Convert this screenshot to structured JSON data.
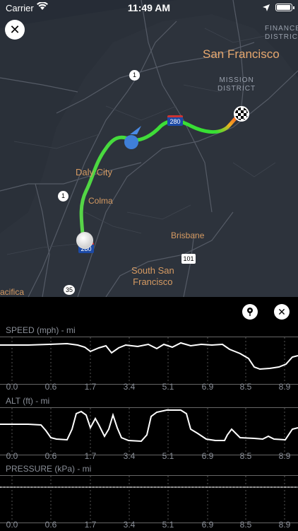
{
  "status": {
    "carrier": "Carrier",
    "time": "11:49 AM",
    "battery_percent": 90
  },
  "map": {
    "labels": {
      "sf": "San Francisco",
      "financial": "FINANCE\nDISTRICT",
      "mission": "MISSION\nDISTRICT",
      "daly": "Daly City",
      "colma": "Colma",
      "brisbane": "Brisbane",
      "ssf": "South San\nFrancisco",
      "pacifica": "acifica"
    },
    "shields": {
      "r1a": "1",
      "r1b": "1",
      "i280a": "280",
      "i280b": "280",
      "r35": "35",
      "us101": "101"
    }
  },
  "charts": {
    "speed": {
      "title": "SPEED (mph) - mi"
    },
    "alt": {
      "title": "ALT (ft) - mi"
    },
    "pressure": {
      "title": "PRESSURE (kPa) - mi"
    },
    "ticks": [
      "0.0",
      "0.6",
      "1.7",
      "3.4",
      "5.1",
      "6.9",
      "8.5",
      "8.9"
    ]
  }
}
